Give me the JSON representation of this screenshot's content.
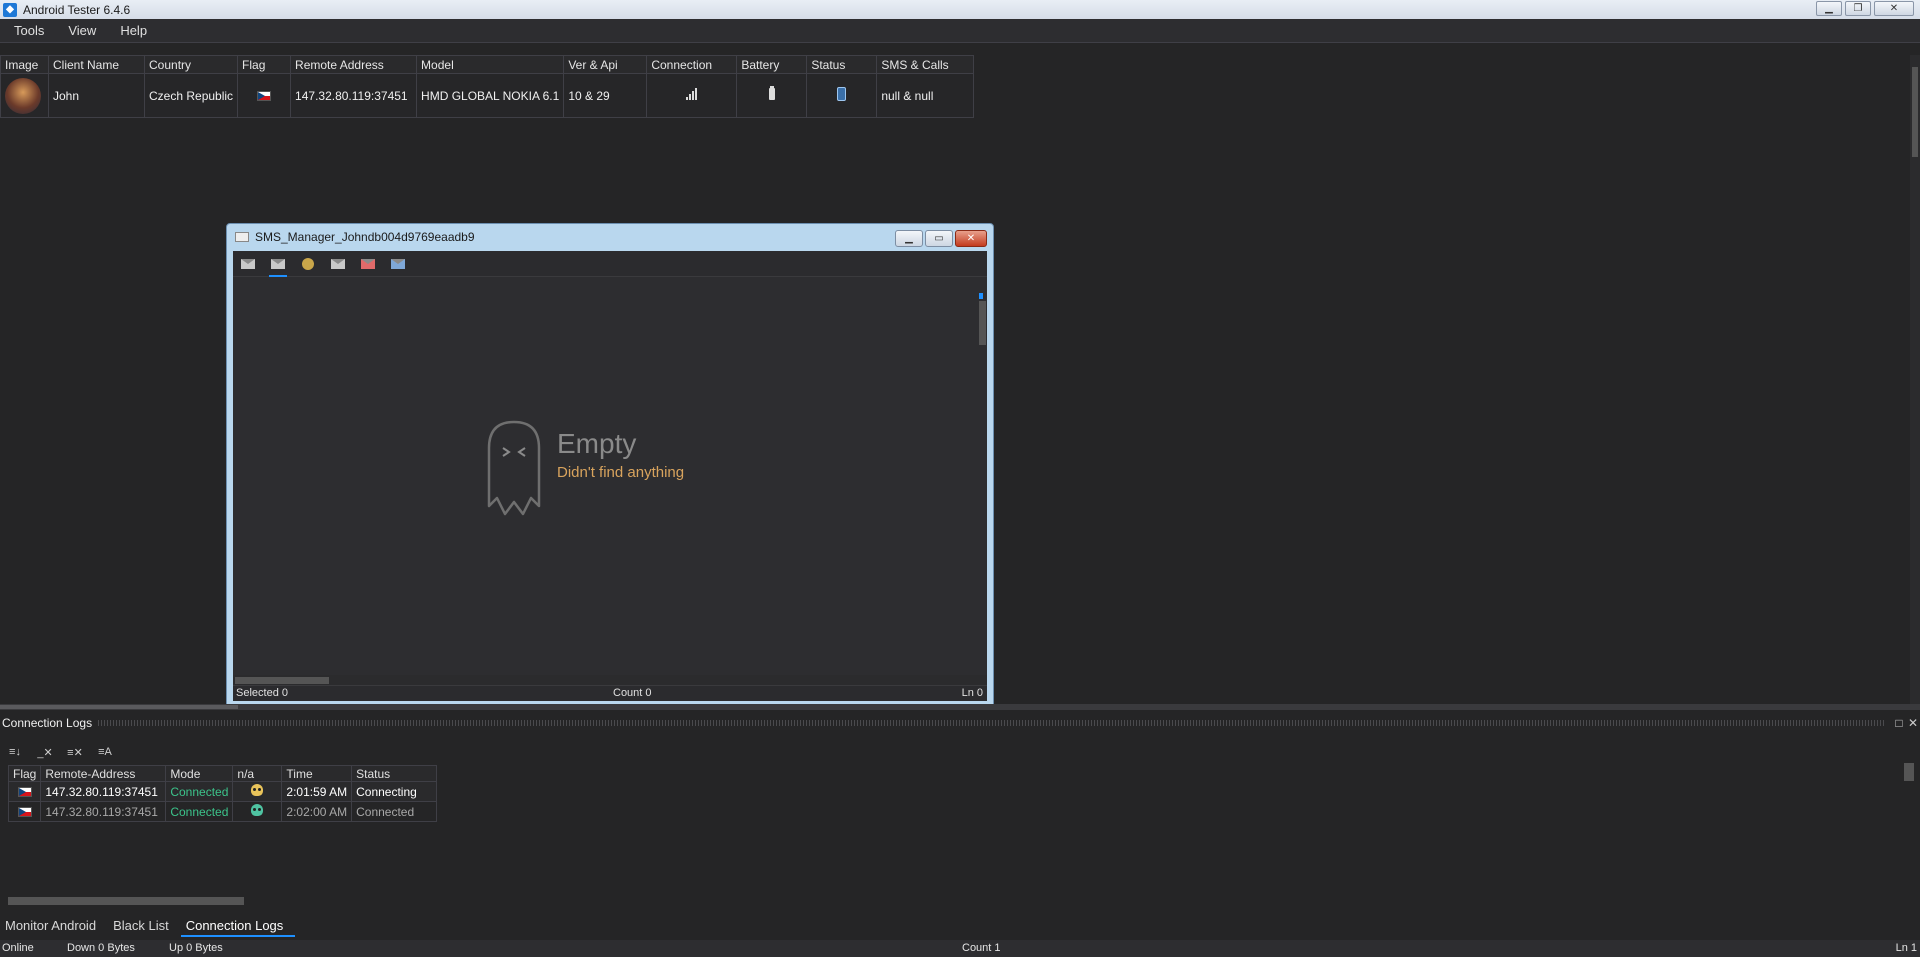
{
  "window": {
    "title": "Android Tester 6.4.6"
  },
  "menu": [
    "Tools",
    "View",
    "Help"
  ],
  "clients_table": {
    "columns": [
      "Image",
      "Client Name",
      "Country",
      "Flag",
      "Remote Address",
      "Model",
      "Ver & Api",
      "Connection",
      "Battery",
      "Status",
      "SMS & Calls"
    ],
    "rows": [
      {
        "client_name": "John",
        "country": "Czech Republic",
        "remote_address": "147.32.80.119:37451",
        "model": "HMD GLOBAL NOKIA 6.1",
        "ver_api": "10 & 29",
        "sms_calls": "null & null"
      }
    ]
  },
  "sms_manager": {
    "title": "SMS_Manager_Johndb004d9769eaadb9",
    "empty_title": "Empty",
    "empty_subtitle": "Didn't find anything",
    "selected": "Selected 0",
    "count": "Count 0",
    "ln": "Ln 0"
  },
  "connection_logs": {
    "title": "Connection Logs",
    "columns": [
      "Flag",
      "Remote-Address",
      "Mode",
      "n/a",
      "Time",
      "Status"
    ],
    "rows": [
      {
        "remote_address": "147.32.80.119:37451",
        "mode": "Connected",
        "time": "2:01:59 AM",
        "status": "Connecting"
      },
      {
        "remote_address": "147.32.80.119:37451",
        "mode": "Connected",
        "time": "2:02:00 AM",
        "status": "Connected"
      }
    ]
  },
  "bottom_tabs": [
    "Monitor Android",
    "Black List",
    "Connection Logs"
  ],
  "statusbar": {
    "online": "Online",
    "down": "Down 0 Bytes",
    "up": "Up 0 Bytes",
    "count": "Count 1",
    "ln": "Ln 1"
  },
  "colors": {
    "accent": "#1e90ff",
    "connected_green": "#3cc48b",
    "empty_subtitle": "#d8a35d"
  }
}
